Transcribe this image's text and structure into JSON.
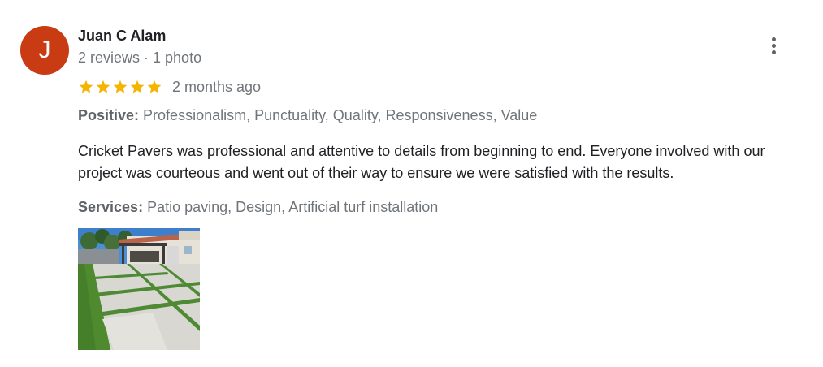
{
  "reviewer": {
    "initial": "J",
    "name": "Juan C Alam",
    "meta": "2 reviews · 1 photo",
    "avatar_color": "#c93b13"
  },
  "more_icon": "more-vert-icon",
  "rating": {
    "stars": 5,
    "max_stars": 5,
    "star_color": "#f4b400",
    "date": "2 months ago"
  },
  "positive": {
    "label": "Positive:",
    "value": "Professionalism, Punctuality, Quality, Responsiveness, Value"
  },
  "text": "Cricket Pavers was professional and attentive to details from beginning to end. Everyone involved with our project was courteous and went out of their way to ensure we were satisfied with the results.",
  "services": {
    "label": "Services:",
    "value": "Patio paving, Design, Artificial turf installation"
  }
}
